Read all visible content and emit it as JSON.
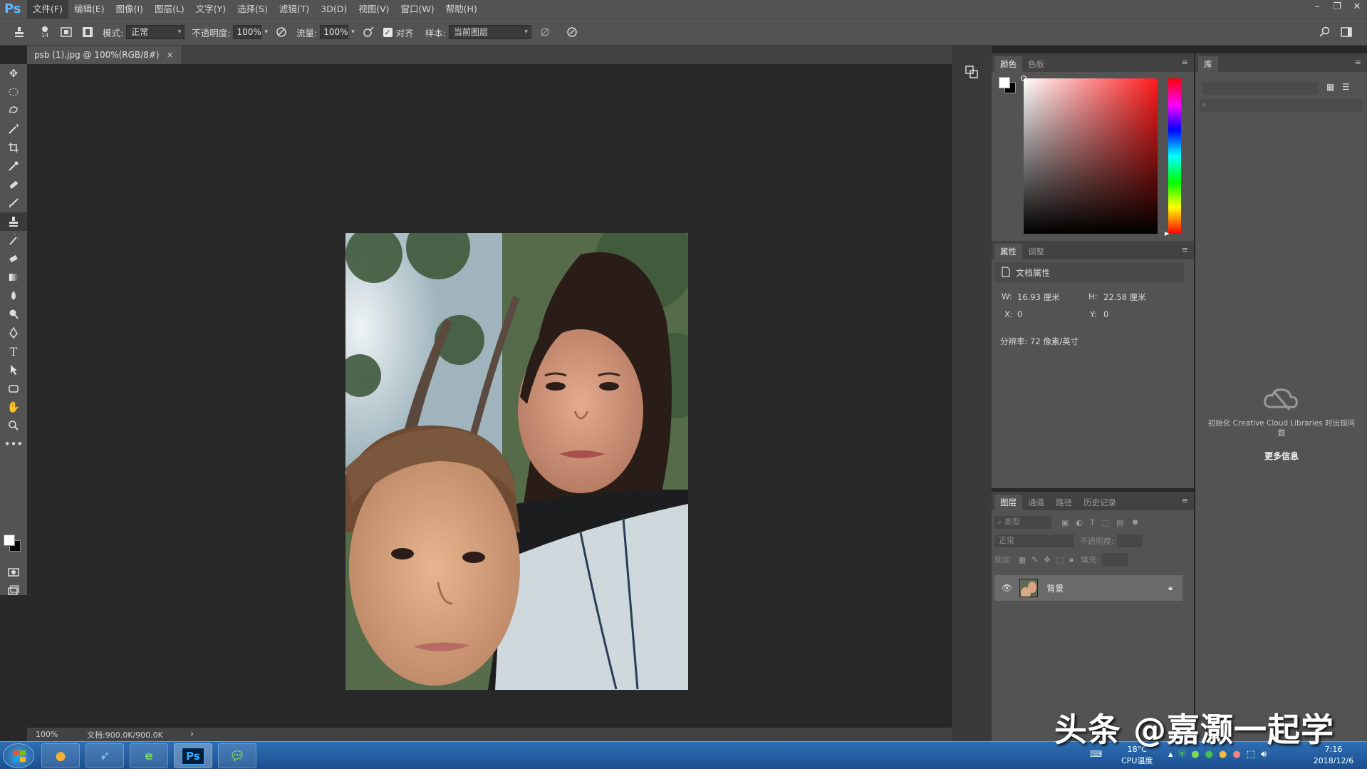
{
  "app": {
    "logo": "Ps"
  },
  "menubar": {
    "items": [
      "文件(F)",
      "编辑(E)",
      "图像(I)",
      "图层(L)",
      "文字(Y)",
      "选择(S)",
      "滤镜(T)",
      "3D(D)",
      "视图(V)",
      "窗口(W)",
      "帮助(H)"
    ],
    "window_controls": [
      "–",
      "❐",
      "✕"
    ]
  },
  "options_bar": {
    "brush_size": "14",
    "mode_label": "模式:",
    "mode_value": "正常",
    "opacity_label": "不透明度:",
    "opacity_value": "100%",
    "flow_label": "流量:",
    "flow_value": "100%",
    "aligned_label": "对齐",
    "aligned_checked": true,
    "sample_label": "样本:",
    "sample_value": "当前图层"
  },
  "document": {
    "tab_title": "psb (1).jpg @ 100%(RGB/8#)",
    "close_glyph": "×"
  },
  "status_bar": {
    "zoom": "100%",
    "doc_size": "文档:900.0K/900.0K",
    "arrow": "›"
  },
  "color_panel": {
    "tabs": [
      "颜色",
      "色板"
    ],
    "active_tab": 0,
    "foreground_color": "#ffffff",
    "background_color": "#000000",
    "hue_color": "#ff0000"
  },
  "properties_panel": {
    "tabs": [
      "属性",
      "调整"
    ],
    "active_tab": 0,
    "section_title": "文档属性",
    "w_label": "W:",
    "w_value": "16.93 厘米",
    "h_label": "H:",
    "h_value": "22.58 厘米",
    "x_label": "X:",
    "x_value": "0",
    "y_label": "Y:",
    "y_value": "0",
    "resolution": "分辨率: 72 像素/英寸"
  },
  "layers_panel": {
    "tabs": [
      "图层",
      "通道",
      "路径",
      "历史记录"
    ],
    "active_tab": 0,
    "filter_placeholder": "类型",
    "blend_mode": "正常",
    "opacity_label": "不透明度:",
    "lock_label": "锁定:",
    "fill_label": "填充:",
    "layers": [
      {
        "name": "背景",
        "visible": true,
        "locked": true
      }
    ]
  },
  "library_panel": {
    "tab": "库",
    "message": "初始化 Creative Cloud Libraries 时出现问题",
    "more_info": "更多信息"
  },
  "taskbar": {
    "temperature": "18°C",
    "cpu_label": "CPU温度",
    "time": "7:16",
    "date": "2018/12/6",
    "photoshop_button": "Ps"
  },
  "watermark": "头条 @嘉灏一起学"
}
